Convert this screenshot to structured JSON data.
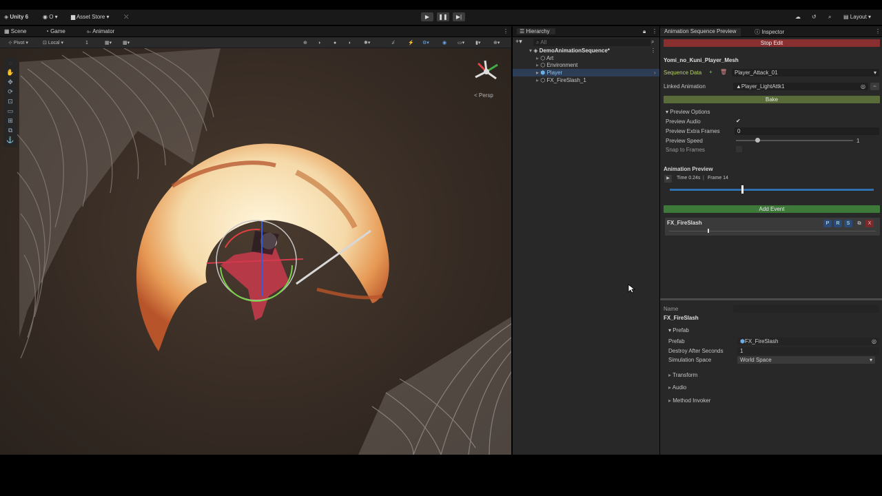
{
  "topbar": {
    "app_name": "Unity 6",
    "account": "O",
    "asset_store": "Asset Store",
    "layout": "Layout"
  },
  "scene_tabs": [
    "Scene",
    "Game",
    "Animator"
  ],
  "scene_toolbar": {
    "pivot": "Pivot",
    "local": "Local",
    "grid_value": "1"
  },
  "viewport": {
    "persp_label": "< Persp"
  },
  "hierarchy": {
    "title": "Hierarchy",
    "search_placeholder": "All",
    "root": "DemoAnimationSequence*",
    "children": [
      "Art",
      "Environment",
      "Player",
      "FX_FireSlash_1"
    ]
  },
  "inspector": {
    "tab_preview": "Animation Sequence Preview",
    "tab_inspector": "Inspector",
    "stop_edit": "Stop Edit",
    "object_name": "Yomi_no_Kuni_Player_Mesh",
    "sequence_data_label": "Sequence Data",
    "sequence_data_value": "Player_Attack_01",
    "linked_animation_label": "Linked Animation",
    "linked_animation_value": "Player_LightAttk1",
    "bake": "Bake",
    "preview_options": "Preview Options",
    "preview_audio_label": "Preview Audio",
    "preview_audio_value": "✔",
    "preview_extra_frames_label": "Preview Extra Frames",
    "preview_extra_frames_value": "0",
    "preview_speed_label": "Preview Speed",
    "preview_speed_value": "1",
    "snap_to_frames_label": "Snap to Frames",
    "animation_preview": "Animation Preview",
    "time_text": "Time 0.24s",
    "frame_text": "Frame 14",
    "timeline_progress": 0.35,
    "add_event": "Add Event",
    "event_name": "FX_FireSlash",
    "event_buttons": [
      "P",
      "R",
      "S",
      "⧉",
      "X"
    ],
    "name_label": "Name",
    "name_value": "FX_FireSlash",
    "prefab_section": "Prefab",
    "prefab_label": "Prefab",
    "prefab_value": "FX_FireSlash",
    "destroy_label": "Destroy After Seconds",
    "destroy_value": "1",
    "sim_space_label": "Simulation Space",
    "sim_space_value": "World Space",
    "sections": [
      "Transform",
      "Audio",
      "Method Invoker"
    ]
  },
  "colors": {
    "stop_edit": "#8a2f2f",
    "bake": "#5a6b3a",
    "add_event": "#3d7a3a",
    "timeline": "#2f6fae",
    "sequence_label": "#b9d36a"
  }
}
